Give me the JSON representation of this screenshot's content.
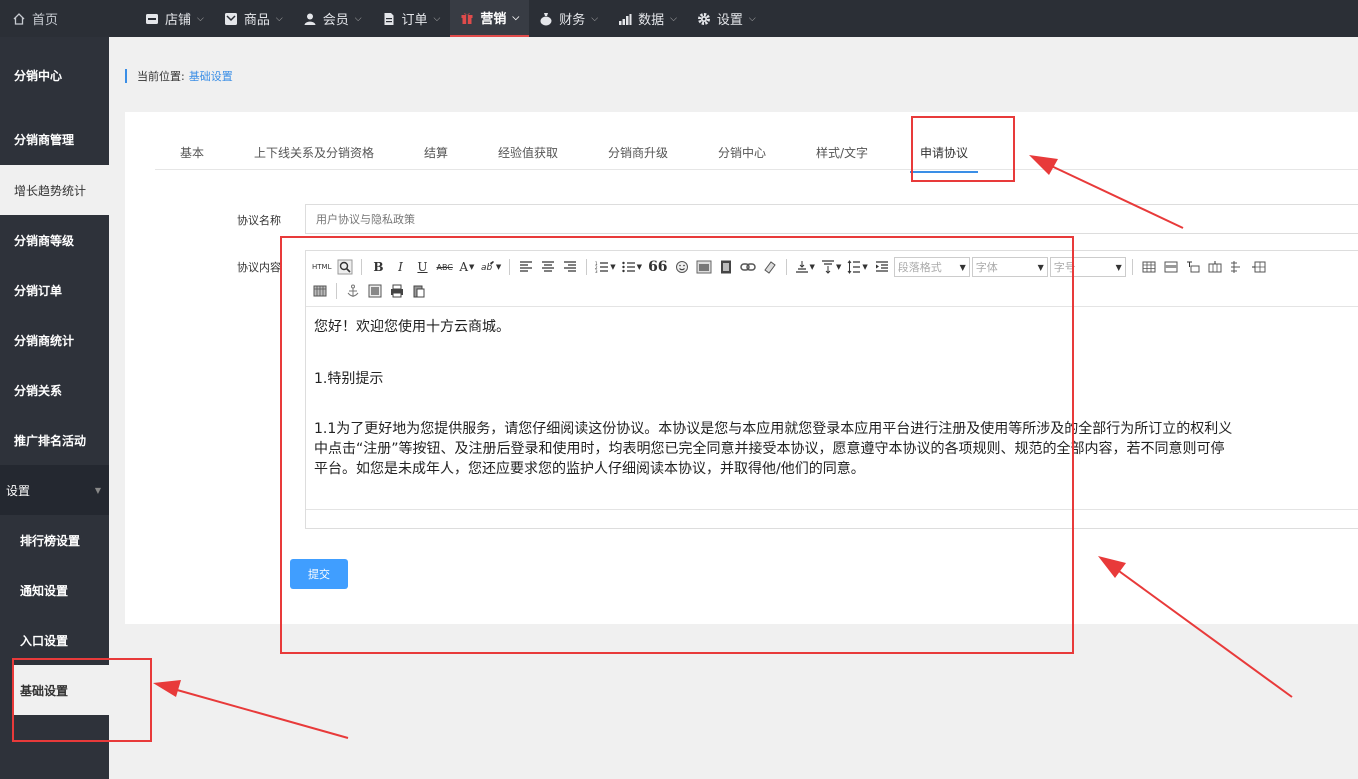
{
  "topnav": {
    "home": "首页",
    "items": [
      {
        "label": "店铺",
        "icon": "store-icon"
      },
      {
        "label": "商品",
        "icon": "goods-icon"
      },
      {
        "label": "会员",
        "icon": "member-icon"
      },
      {
        "label": "订单",
        "icon": "order-icon"
      },
      {
        "label": "营销",
        "icon": "gift-icon",
        "active": true
      },
      {
        "label": "财务",
        "icon": "money-bag-icon"
      },
      {
        "label": "数据",
        "icon": "chart-icon"
      },
      {
        "label": "设置",
        "icon": "gear-icon"
      }
    ]
  },
  "sidebar": {
    "items": [
      {
        "label": "分销中心"
      },
      {
        "label": "分销商管理"
      },
      {
        "label": "增长趋势统计"
      },
      {
        "label": "分销商等级"
      },
      {
        "label": "分销订单"
      },
      {
        "label": "分销商统计"
      },
      {
        "label": "分销关系"
      },
      {
        "label": "推广排名活动"
      }
    ],
    "section": "设置",
    "sub_items": [
      {
        "label": "排行榜设置"
      },
      {
        "label": "通知设置"
      },
      {
        "label": "入口设置"
      },
      {
        "label": "基础设置"
      }
    ]
  },
  "breadcrumb": {
    "prefix": "当前位置:",
    "current": "基础设置"
  },
  "tabs": [
    "基本",
    "上下线关系及分销资格",
    "结算",
    "经验值获取",
    "分销商升级",
    "分销中心",
    "样式/文字",
    "申请协议"
  ],
  "form": {
    "name_label": "协议名称",
    "name_placeholder": "用户协议与隐私政策",
    "content_label": "协议内容",
    "submit": "提交"
  },
  "editor": {
    "html_label": "HTML",
    "bold": "B",
    "italic": "I",
    "underline": "U",
    "strike": "ABC",
    "font_color": "A",
    "quote": "66",
    "paragraph_format": "段落格式",
    "font_family": "字体",
    "font_size": "字号",
    "content": {
      "greeting": "您好！欢迎您使用十方云商城。",
      "heading": "1.特别提示",
      "line1": "1.1为了更好地为您提供服务，请您仔细阅读这份协议。本协议是您与本应用就您登录本应用平台进行注册及使用等所涉及的全部行为所订立的权利义",
      "line2": "中点击“注册”等按钮、及注册后登录和使用时，均表明您已完全同意并接受本协议，愿意遵守本协议的各项规则、规范的全部内容，若不同意则可停",
      "line3": "平台。如您是未成年人，您还应要求您的监护人仔细阅读本协议，并取得他/他们的同意。"
    }
  },
  "colors": {
    "accent": "#409eff",
    "nav_bg": "#2b2f36",
    "sidebar_bg": "#2e323a",
    "annotation": "#e83a3a"
  }
}
